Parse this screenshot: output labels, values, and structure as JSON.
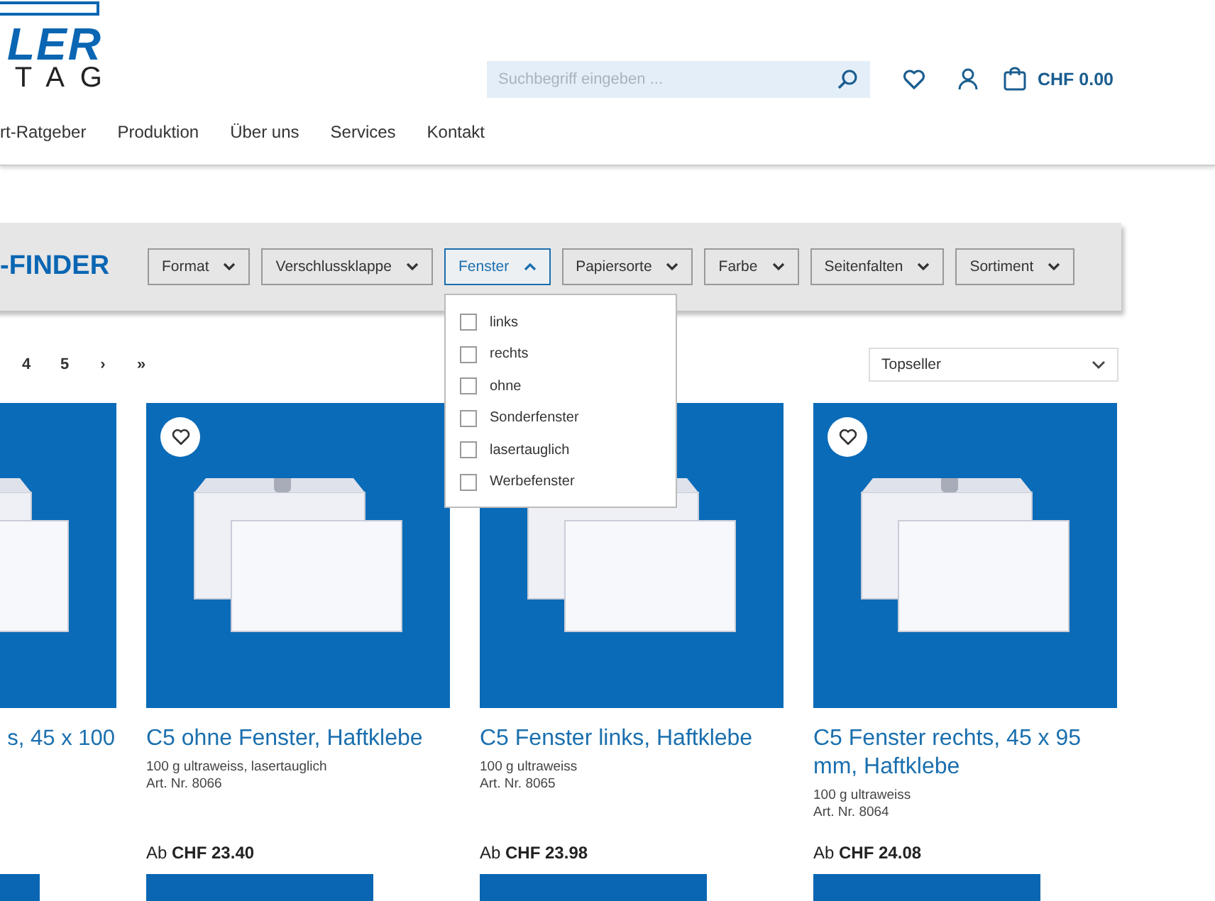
{
  "logo": {
    "top": "LER",
    "bottom": "TAG"
  },
  "search": {
    "placeholder": "Suchbegriff eingeben ..."
  },
  "cart": {
    "total": "CHF 0.00"
  },
  "nav": [
    "rt-Ratgeber",
    "Produktion",
    "Über uns",
    "Services",
    "Kontakt"
  ],
  "finder": {
    "title": "-FINDER",
    "filters": [
      {
        "label": "Format",
        "expanded": false
      },
      {
        "label": "Verschlussklappe",
        "expanded": false
      },
      {
        "label": "Fenster",
        "expanded": true,
        "options": [
          {
            "label": "links",
            "checked": false
          },
          {
            "label": "rechts",
            "checked": false
          },
          {
            "label": "ohne",
            "checked": false
          },
          {
            "label": "Sonderfenster",
            "checked": false
          },
          {
            "label": "lasertauglich",
            "checked": false
          },
          {
            "label": "Werbefenster",
            "checked": false
          }
        ]
      },
      {
        "label": "Papiersorte",
        "expanded": false
      },
      {
        "label": "Farbe",
        "expanded": false
      },
      {
        "label": "Seitenfalten",
        "expanded": false
      },
      {
        "label": "Sortiment",
        "expanded": false
      }
    ]
  },
  "pagination": [
    "4",
    "5",
    "›",
    "»"
  ],
  "sort": {
    "value": "Topseller"
  },
  "products": [
    {
      "kind": "partial",
      "title": "s, 45 x 100"
    },
    {
      "kind": "full",
      "title": "C5 ohne Fenster, Haftklebe",
      "description": "100 g ultraweiss, lasertauglich",
      "article": "Art. Nr. 8066",
      "price": "Ab **CHF 23.40**"
    },
    {
      "kind": "full",
      "title": "C5 Fenster links, Haftklebe",
      "description": "100 g ultraweiss",
      "article": "Art. Nr. 8065",
      "price": "Ab **CHF 23.98**"
    },
    {
      "kind": "full",
      "title": "C5 Fenster rechts, 45 x 95 mm, Haftklebe",
      "description": "100 g ultraweiss",
      "article": "Art. Nr. 8064",
      "price": "Ab **CHF 24.08**"
    }
  ]
}
